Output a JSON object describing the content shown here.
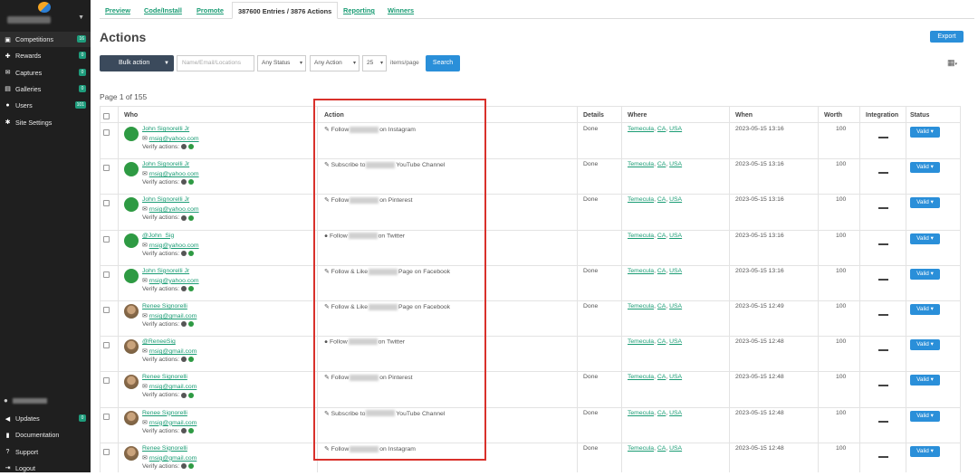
{
  "sidebar": {
    "items": [
      {
        "label": "Competitions",
        "icon": "trophy-icon",
        "badge": "16"
      },
      {
        "label": "Rewards",
        "icon": "gift-icon",
        "badge": "0"
      },
      {
        "label": "Captures",
        "icon": "envelope-icon",
        "badge": "0"
      },
      {
        "label": "Galleries",
        "icon": "image-icon",
        "badge": "0"
      },
      {
        "label": "Users",
        "icon": "users-icon",
        "badge": "101"
      },
      {
        "label": "Site Settings",
        "icon": "gear-icon",
        "badge": ""
      }
    ],
    "bottom": [
      {
        "label": "Updates",
        "icon": "megaphone-icon",
        "badge": "0"
      },
      {
        "label": "Documentation",
        "icon": "book-icon",
        "badge": ""
      },
      {
        "label": "Support",
        "icon": "question-icon",
        "badge": ""
      },
      {
        "label": "Logout",
        "icon": "logout-icon",
        "badge": ""
      }
    ]
  },
  "tabs": [
    "Preview",
    "Code/Install",
    "Promote",
    "387600 Entries / 3876 Actions",
    "Reporting",
    "Winners"
  ],
  "page": {
    "title": "Actions",
    "export_label": "Export",
    "page_info": "Page 1 of 155"
  },
  "toolbar": {
    "bulk_label": "Bulk action",
    "search_placeholder": "Name/Email/Locations",
    "status_select": "Any Status",
    "action_select": "Any Action",
    "per_page_select": "25",
    "items_per_page_label": "items/page",
    "search_label": "Search"
  },
  "table": {
    "columns": [
      "Who",
      "Action",
      "Details",
      "Where",
      "When",
      "Worth",
      "Integration",
      "Status"
    ],
    "verify_label": "Verify actions:",
    "rows": [
      {
        "avatar": "green",
        "name": "John Signorelli Jr",
        "email": "rnsig@yahoo.com",
        "action_pre": "Follow",
        "action_post": "on Instagram",
        "action_icon": "edit-icon",
        "details": "Done",
        "city": "Temecula",
        "state": "CA",
        "country": "USA",
        "when": "2023-05-15 13:16",
        "worth": "100",
        "status": "Valid"
      },
      {
        "avatar": "green",
        "name": "John Signorelli Jr",
        "email": "rnsig@yahoo.com",
        "action_pre": "Subscribe to",
        "action_post": "YouTube Channel",
        "action_icon": "edit-icon",
        "details": "Done",
        "city": "Temecula",
        "state": "CA",
        "country": "USA",
        "when": "2023-05-15 13:16",
        "worth": "100",
        "status": "Valid"
      },
      {
        "avatar": "green",
        "name": "John Signorelli Jr",
        "email": "rnsig@yahoo.com",
        "action_pre": "Follow",
        "action_post": "on Pinterest",
        "action_icon": "edit-icon",
        "details": "Done",
        "city": "Temecula",
        "state": "CA",
        "country": "USA",
        "when": "2023-05-15 13:16",
        "worth": "100",
        "status": "Valid"
      },
      {
        "avatar": "green",
        "name": "@John_Sig",
        "email": "rnsig@yahoo.com",
        "action_pre": "Follow",
        "action_post": "on Twitter",
        "action_icon": "user-icon",
        "details": "",
        "city": "Temecula",
        "state": "CA",
        "country": "USA",
        "when": "2023-05-15 13:16",
        "worth": "100",
        "status": "Valid"
      },
      {
        "avatar": "green",
        "name": "John Signorelli Jr",
        "email": "rnsig@yahoo.com",
        "action_pre": "Follow & Like",
        "action_post": "Page on Facebook",
        "action_icon": "edit-icon",
        "details": "Done",
        "city": "Temecula",
        "state": "CA",
        "country": "USA",
        "when": "2023-05-15 13:16",
        "worth": "100",
        "status": "Valid"
      },
      {
        "avatar": "photo",
        "name": "Renee Signorelli",
        "email": "rnsig@gmail.com",
        "action_pre": "Follow & Like",
        "action_post": "Page on Facebook",
        "action_icon": "edit-icon",
        "details": "Done",
        "city": "Temecula",
        "state": "CA",
        "country": "USA",
        "when": "2023-05-15 12:49",
        "worth": "100",
        "status": "Valid"
      },
      {
        "avatar": "photo",
        "name": "@ReneeSig",
        "email": "rnsig@gmail.com",
        "action_pre": "Follow",
        "action_post": "on Twitter",
        "action_icon": "user-icon",
        "details": "",
        "city": "Temecula",
        "state": "CA",
        "country": "USA",
        "when": "2023-05-15 12:48",
        "worth": "100",
        "status": "Valid"
      },
      {
        "avatar": "photo",
        "name": "Renee Signorelli",
        "email": "rnsig@gmail.com",
        "action_pre": "Follow",
        "action_post": "on Pinterest",
        "action_icon": "edit-icon",
        "details": "Done",
        "city": "Temecula",
        "state": "CA",
        "country": "USA",
        "when": "2023-05-15 12:48",
        "worth": "100",
        "status": "Valid"
      },
      {
        "avatar": "photo",
        "name": "Renee Signorelli",
        "email": "rnsig@gmail.com",
        "action_pre": "Subscribe to",
        "action_post": "YouTube Channel",
        "action_icon": "edit-icon",
        "details": "Done",
        "city": "Temecula",
        "state": "CA",
        "country": "USA",
        "when": "2023-05-15 12:48",
        "worth": "100",
        "status": "Valid"
      },
      {
        "avatar": "photo",
        "name": "Renee Signorelli",
        "email": "rnsig@gmail.com",
        "action_pre": "Follow",
        "action_post": "on Instagram",
        "action_icon": "edit-icon",
        "details": "Done",
        "city": "Temecula",
        "state": "CA",
        "country": "USA",
        "when": "2023-05-15 12:48",
        "worth": "100",
        "status": "Valid"
      }
    ]
  },
  "colors": {
    "accent": "#1a9c74",
    "primary_button": "#2a8fd9",
    "sidebar_bg": "#1f1f1f",
    "highlight_box": "#d9312b"
  }
}
